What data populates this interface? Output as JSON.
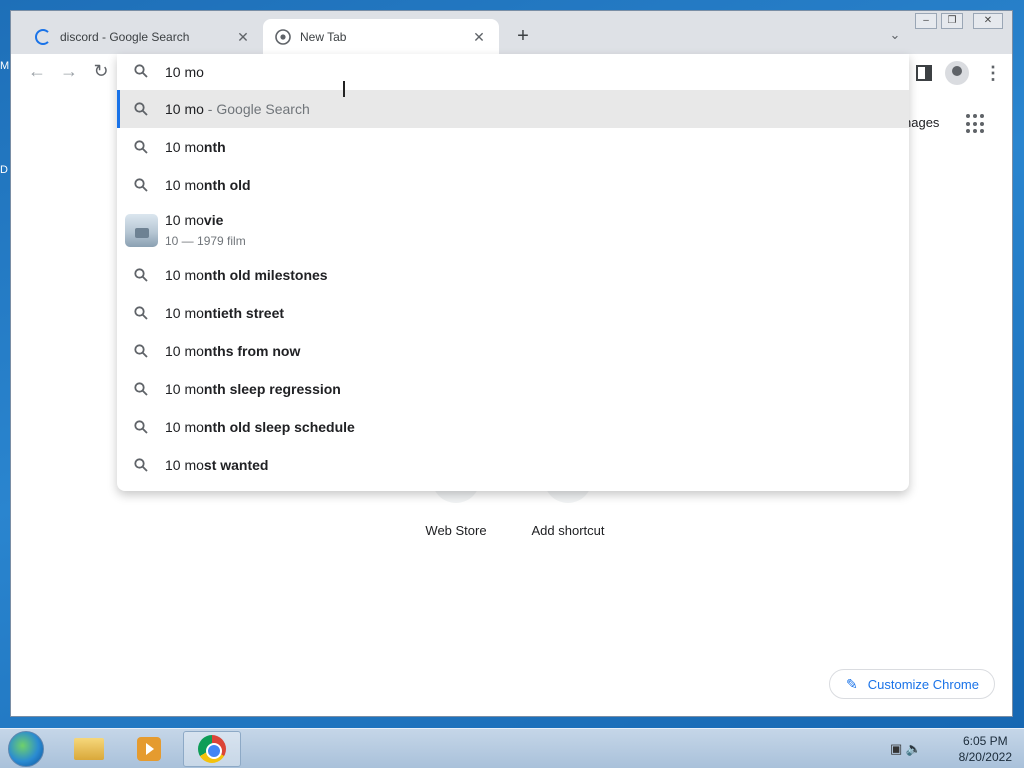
{
  "desktop": {
    "icon_label_1": "M",
    "icon_label_2": "D"
  },
  "tabs": [
    {
      "title": "discord - Google Search",
      "loading": true
    },
    {
      "title": "New Tab",
      "active": true
    }
  ],
  "omnibox": {
    "value": "10 mo",
    "suggestions": [
      {
        "typed": "10 mo",
        "completion": "",
        "suffix": " - Google Search",
        "icon": "search-icon",
        "selected": true
      },
      {
        "typed": "10 mo",
        "completion": "nth",
        "icon": "search-icon"
      },
      {
        "typed": "10 mo",
        "completion": "nth old",
        "icon": "search-icon"
      },
      {
        "typed": "10 mo",
        "completion": "vie",
        "subtitle": "10 — 1979 film",
        "icon": "movie-thumbnail"
      },
      {
        "typed": "10 mo",
        "completion": "nth old milestones",
        "icon": "search-icon"
      },
      {
        "typed": "10 mo",
        "completion": "ntieth street",
        "icon": "search-icon"
      },
      {
        "typed": "10 mo",
        "completion": "nths from now",
        "icon": "search-icon"
      },
      {
        "typed": "10 mo",
        "completion": "nth sleep regression",
        "icon": "search-icon"
      },
      {
        "typed": "10 mo",
        "completion": "nth old sleep schedule",
        "icon": "search-icon"
      },
      {
        "typed": "10 mo",
        "completion": "st wanted",
        "icon": "search-icon"
      }
    ]
  },
  "ntp": {
    "images_link": "nages",
    "shortcuts": [
      {
        "label": "Web Store"
      },
      {
        "label": "Add shortcut"
      }
    ],
    "customize_label": "Customize Chrome"
  },
  "taskbar": {
    "time": "6:05 PM",
    "date": "8/20/2022"
  },
  "colors": {
    "accent": "#1a73e8",
    "selected_row": "#e8e8e8",
    "tabstrip": "#dee1e6"
  }
}
